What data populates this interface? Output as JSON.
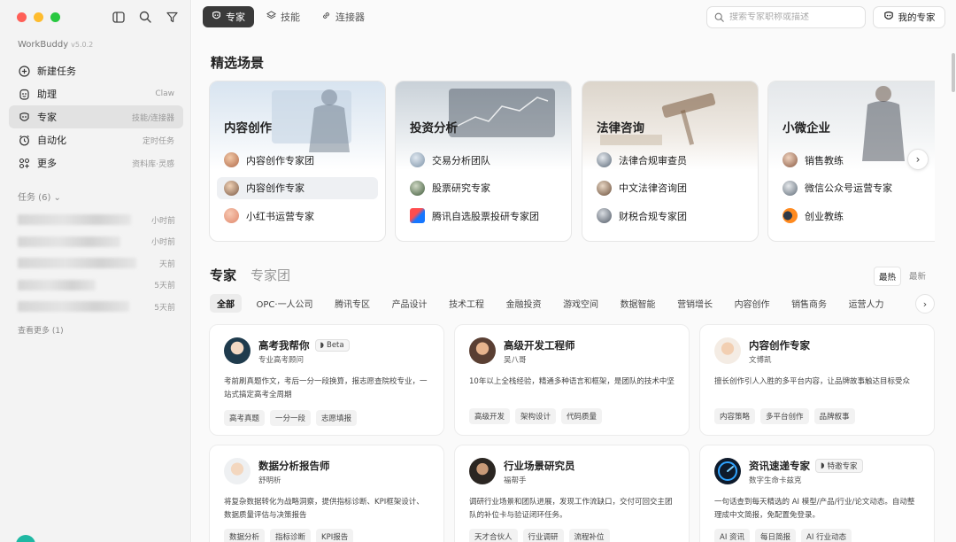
{
  "app": {
    "name": "WorkBuddy",
    "version": "v5.0.2"
  },
  "sidebar": {
    "items": [
      {
        "label": "新建任务",
        "hint": "",
        "icon": "plus-circle-icon"
      },
      {
        "label": "助理",
        "hint": "Claw",
        "icon": "assistant-icon"
      },
      {
        "label": "专家",
        "hint": "技能/连接器",
        "icon": "expert-icon"
      },
      {
        "label": "自动化",
        "hint": "定时任务",
        "icon": "alarm-clock-icon"
      },
      {
        "label": "更多",
        "hint": "资料库·灵感",
        "icon": "grid-icon"
      }
    ],
    "tasks_label": "任务 (6)",
    "tasks": [
      {
        "time": "小时前"
      },
      {
        "time": "小时前"
      },
      {
        "time": "天前"
      },
      {
        "time": "5天前"
      },
      {
        "time": "5天前"
      }
    ],
    "see_more": "查看更多 (1)"
  },
  "topbar": {
    "tabs": [
      {
        "label": "专家",
        "icon": "expert-icon"
      },
      {
        "label": "技能",
        "icon": "skill-icon"
      },
      {
        "label": "连接器",
        "icon": "link-icon"
      }
    ],
    "search_placeholder": "搜索专家职称或描述",
    "my_experts": "我的专家"
  },
  "featured": {
    "title": "精选场景",
    "scenes": [
      {
        "title": "内容创作",
        "items": [
          "内容创作专家团",
          "内容创作专家",
          "小红书运营专家"
        ]
      },
      {
        "title": "投资分析",
        "items": [
          "交易分析团队",
          "股票研究专家",
          "腾讯自选股票投研专家团"
        ]
      },
      {
        "title": "法律咨询",
        "items": [
          "法律合规审查员",
          "中文法律咨询团",
          "财税合规专家团"
        ]
      },
      {
        "title": "小微企业",
        "items": [
          "销售教练",
          "微信公众号运营专家",
          "创业教练"
        ]
      }
    ]
  },
  "experts": {
    "title": "专家",
    "title_alt": "专家团",
    "sort": [
      "最热",
      "最新"
    ],
    "categories": [
      "全部",
      "OPC·一人公司",
      "腾讯专区",
      "产品设计",
      "技术工程",
      "金融投资",
      "游戏空间",
      "数据智能",
      "营销增长",
      "内容创作",
      "销售商务",
      "运营人力"
    ],
    "cards": [
      {
        "name": "高考我帮你",
        "badge": "Beta",
        "sub": "专业高考顾问",
        "desc": "考前刷真题作文，考后一分一段换算，报志愿查院校专业，一站式搞定高考全周期",
        "tags": [
          "高考真题",
          "一分一段",
          "志愿填报"
        ]
      },
      {
        "name": "高级开发工程师",
        "badge": "",
        "sub": "吴八哥",
        "desc": "10年以上全栈经验，精通多种语言和框架，是团队的技术中坚",
        "tags": [
          "高级开发",
          "架构设计",
          "代码质量"
        ]
      },
      {
        "name": "内容创作专家",
        "badge": "",
        "sub": "文博凯",
        "desc": "擅长创作引人入胜的多平台内容，让品牌故事触达目标受众",
        "tags": [
          "内容策略",
          "多平台创作",
          "品牌叙事"
        ]
      },
      {
        "name": "数据分析报告师",
        "badge": "",
        "sub": "舒明析",
        "desc": "将复杂数据转化为战略洞察，提供指标诊断、KPI框架设计、数据质量评估与决策报告",
        "tags": [
          "数据分析",
          "指标诊断",
          "KPI报告"
        ]
      },
      {
        "name": "行业场景研究员",
        "badge": "",
        "sub": "福帮手",
        "desc": "调研行业场景和团队进展，发现工作流缺口，交付可回交主团队的补位卡与验证闭环任务。",
        "tags": [
          "天才合伙人",
          "行业调研",
          "流程补位"
        ]
      },
      {
        "name": "资讯速递专家",
        "badge": "特邀专家",
        "sub": "数字生命卡兹克",
        "desc": "一句话查到每天精选的 AI 模型/产品/行业/论文动态。自动整理成中文简报，免配置免登录。",
        "tags": [
          "AI 资讯",
          "每日简报",
          "AI 行业动态"
        ]
      }
    ]
  },
  "colors": {
    "accent_dark": "#3a3a3a",
    "sidebar_bg": "#f3f3f3",
    "main_bg": "#fafafa"
  }
}
